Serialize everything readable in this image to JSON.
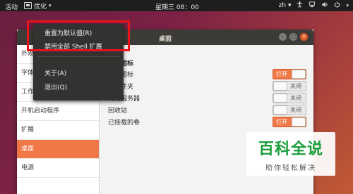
{
  "topbar": {
    "activities": "活动",
    "app_name": "优化",
    "clock": "星期三 08：00",
    "lang": "zh",
    "caret": "▾"
  },
  "window": {
    "title": "桌面"
  },
  "sidebar": {
    "items": [
      {
        "label": "外观"
      },
      {
        "label": "字体"
      },
      {
        "label": "工作区"
      },
      {
        "label": "开机启动程序"
      },
      {
        "label": "扩展"
      },
      {
        "label": "桌面",
        "active": true
      },
      {
        "label": "电源"
      }
    ]
  },
  "content": {
    "section_title": "桌面图标",
    "rows": [
      {
        "label": "显示图标",
        "state": "打开",
        "on": true
      },
      {
        "label": "主文件夹",
        "state": "关闭",
        "on": false
      },
      {
        "label": "网络服务器",
        "state": "关闭",
        "on": false
      },
      {
        "label": "回收站",
        "state": "关闭",
        "on": false
      },
      {
        "label": "已挂载的卷",
        "state": "打开",
        "on": true
      }
    ]
  },
  "menu": {
    "items": [
      {
        "label": "重置为默认值(R)"
      },
      {
        "label": "禁用全部 Shell 扩展"
      },
      {
        "label": "关于(A)"
      },
      {
        "label": "退出(Q)"
      }
    ]
  },
  "watermark": {
    "title": "百科全说",
    "subtitle": "助你轻松解决"
  },
  "colors": {
    "accent": "#f07746",
    "highlight": "#e8141a",
    "topbar": "#1e1e1e",
    "titlebar": "#3c3b37"
  }
}
